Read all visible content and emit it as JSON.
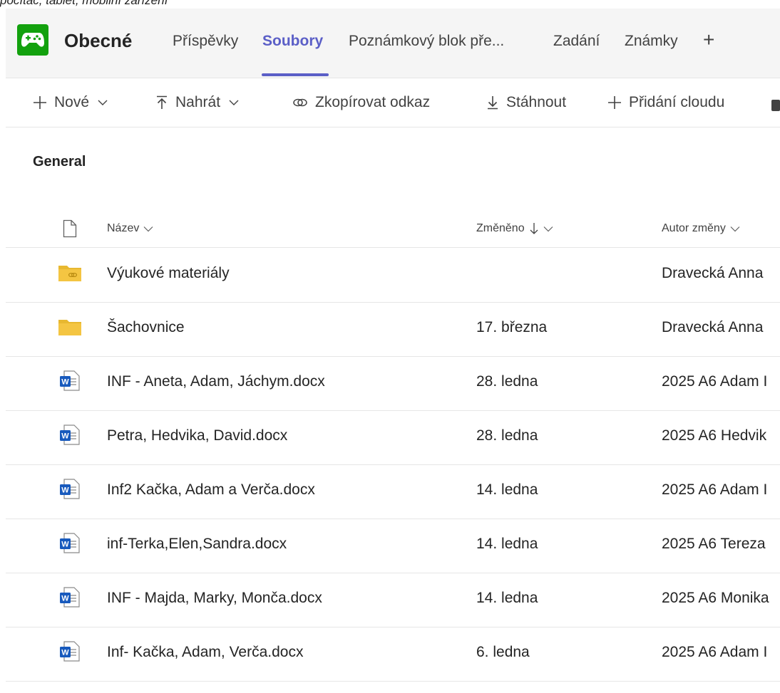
{
  "caption": "počítač, tablet, mobilní zařízení",
  "header": {
    "team_name": "Obecné",
    "tabs": [
      {
        "label": "Příspěvky"
      },
      {
        "label": "Soubory"
      },
      {
        "label": "Poznámkový blok pře..."
      },
      {
        "label": "Zadání"
      },
      {
        "label": "Známky"
      }
    ],
    "add_tab_label": "+"
  },
  "toolbar": {
    "new_label": "Nové",
    "upload_label": "Nahrát",
    "copy_link_label": "Zkopírovat odkaz",
    "download_label": "Stáhnout",
    "add_cloud_label": "Přidání cloudu"
  },
  "section_title": "General",
  "table": {
    "columns": {
      "name": "Název",
      "modified": "Změněno",
      "modified_by": "Autor změny"
    },
    "rows": [
      {
        "type": "shared-folder",
        "name": "Výukové materiály",
        "modified": "",
        "modified_by": "Dravecká Anna"
      },
      {
        "type": "folder",
        "name": "Šachovnice",
        "modified": "17. března",
        "modified_by": "Dravecká Anna"
      },
      {
        "type": "word",
        "name": "INF - Aneta, Adam, Jáchym.docx",
        "modified": "28. ledna",
        "modified_by": "2025 A6 Adam I"
      },
      {
        "type": "word",
        "name": "Petra, Hedvika, David.docx",
        "modified": "28. ledna",
        "modified_by": "2025 A6 Hedvik"
      },
      {
        "type": "word",
        "name": "Inf2 Kačka, Adam a Verča.docx",
        "modified": "14. ledna",
        "modified_by": "2025 A6 Adam I"
      },
      {
        "type": "word",
        "name": "inf-Terka,Elen,Sandra.docx",
        "modified": "14. ledna",
        "modified_by": "2025 A6 Tereza"
      },
      {
        "type": "word",
        "name": "INF - Majda, Marky, Monča.docx",
        "modified": "14. ledna",
        "modified_by": "2025 A6 Monika"
      },
      {
        "type": "word",
        "name": "Inf- Kačka, Adam, Verča.docx",
        "modified": "6. ledna",
        "modified_by": "2025 A6 Adam I"
      }
    ]
  },
  "colors": {
    "accent": "#5b5fc7",
    "team_avatar": "#13a10e",
    "folder": "#f4c542",
    "word": "#185abd"
  }
}
